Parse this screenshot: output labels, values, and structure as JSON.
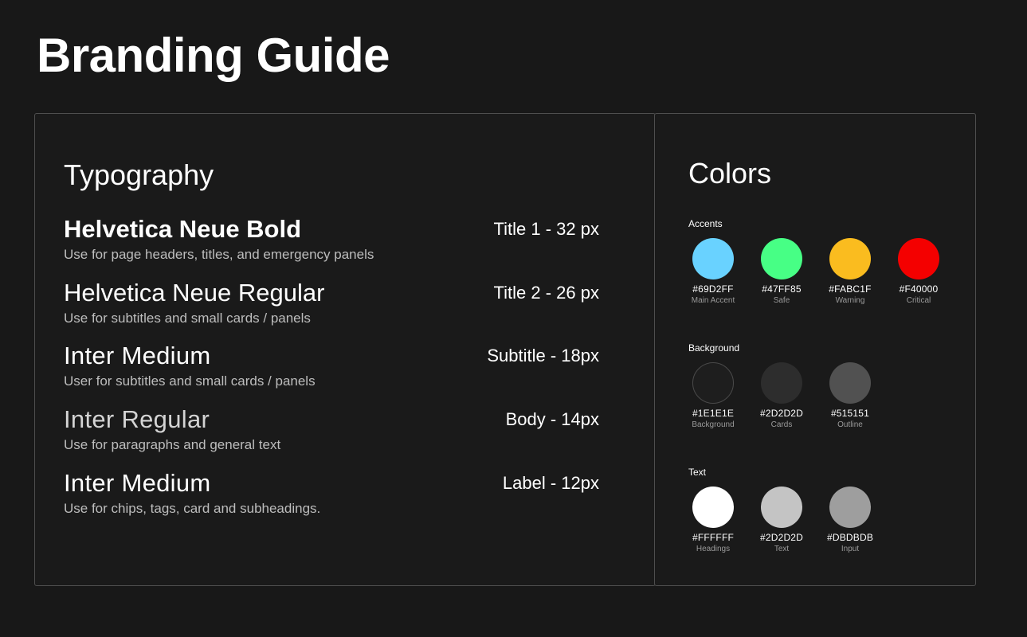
{
  "page": {
    "title": "Branding Guide"
  },
  "typography": {
    "title": "Typography",
    "items": [
      {
        "name": "Helvetica Neue Bold",
        "size": "Title 1 - 32 px",
        "description": "Use for page headers, titles, and emergency panels"
      },
      {
        "name": "Helvetica Neue Regular",
        "size": "Title 2 - 26 px",
        "description": "Use for subtitles and small cards / panels"
      },
      {
        "name": "Inter Medium",
        "size": "Subtitle - 18px",
        "description": "User for subtitles and small cards / panels"
      },
      {
        "name": "Inter Regular",
        "size": "Body - 14px",
        "description": "Use for paragraphs and general text"
      },
      {
        "name": "Inter Medium",
        "size": "Label - 12px",
        "description": "Use for chips, tags, card and subheadings."
      }
    ]
  },
  "colors": {
    "title": "Colors",
    "groups": [
      {
        "label": "Accents",
        "swatches": [
          {
            "hex": "#69D2FF",
            "name": "Main Accent",
            "color": "#69D2FF"
          },
          {
            "hex": "#47FF85",
            "name": "Safe",
            "color": "#47FF85"
          },
          {
            "hex": "#FABC1F",
            "name": "Warning",
            "color": "#FABC1F"
          },
          {
            "hex": "#F40000",
            "name": "Critical",
            "color": "#F40000"
          }
        ]
      },
      {
        "label": "Background",
        "swatches": [
          {
            "hex": "#1E1E1E",
            "name": "Background",
            "color": "#1E1E1E"
          },
          {
            "hex": "#2D2D2D",
            "name": "Cards",
            "color": "#2D2D2D"
          },
          {
            "hex": "#515151",
            "name": "Outline",
            "color": "#515151"
          }
        ]
      },
      {
        "label": "Text",
        "swatches": [
          {
            "hex": "#FFFFFF",
            "name": "Headings",
            "color": "#FFFFFF"
          },
          {
            "hex": "#2D2D2D",
            "name": "Text",
            "color": "#C4C4C4"
          },
          {
            "hex": "#DBDBDB",
            "name": "Input",
            "color": "#9E9E9E"
          }
        ]
      }
    ]
  }
}
